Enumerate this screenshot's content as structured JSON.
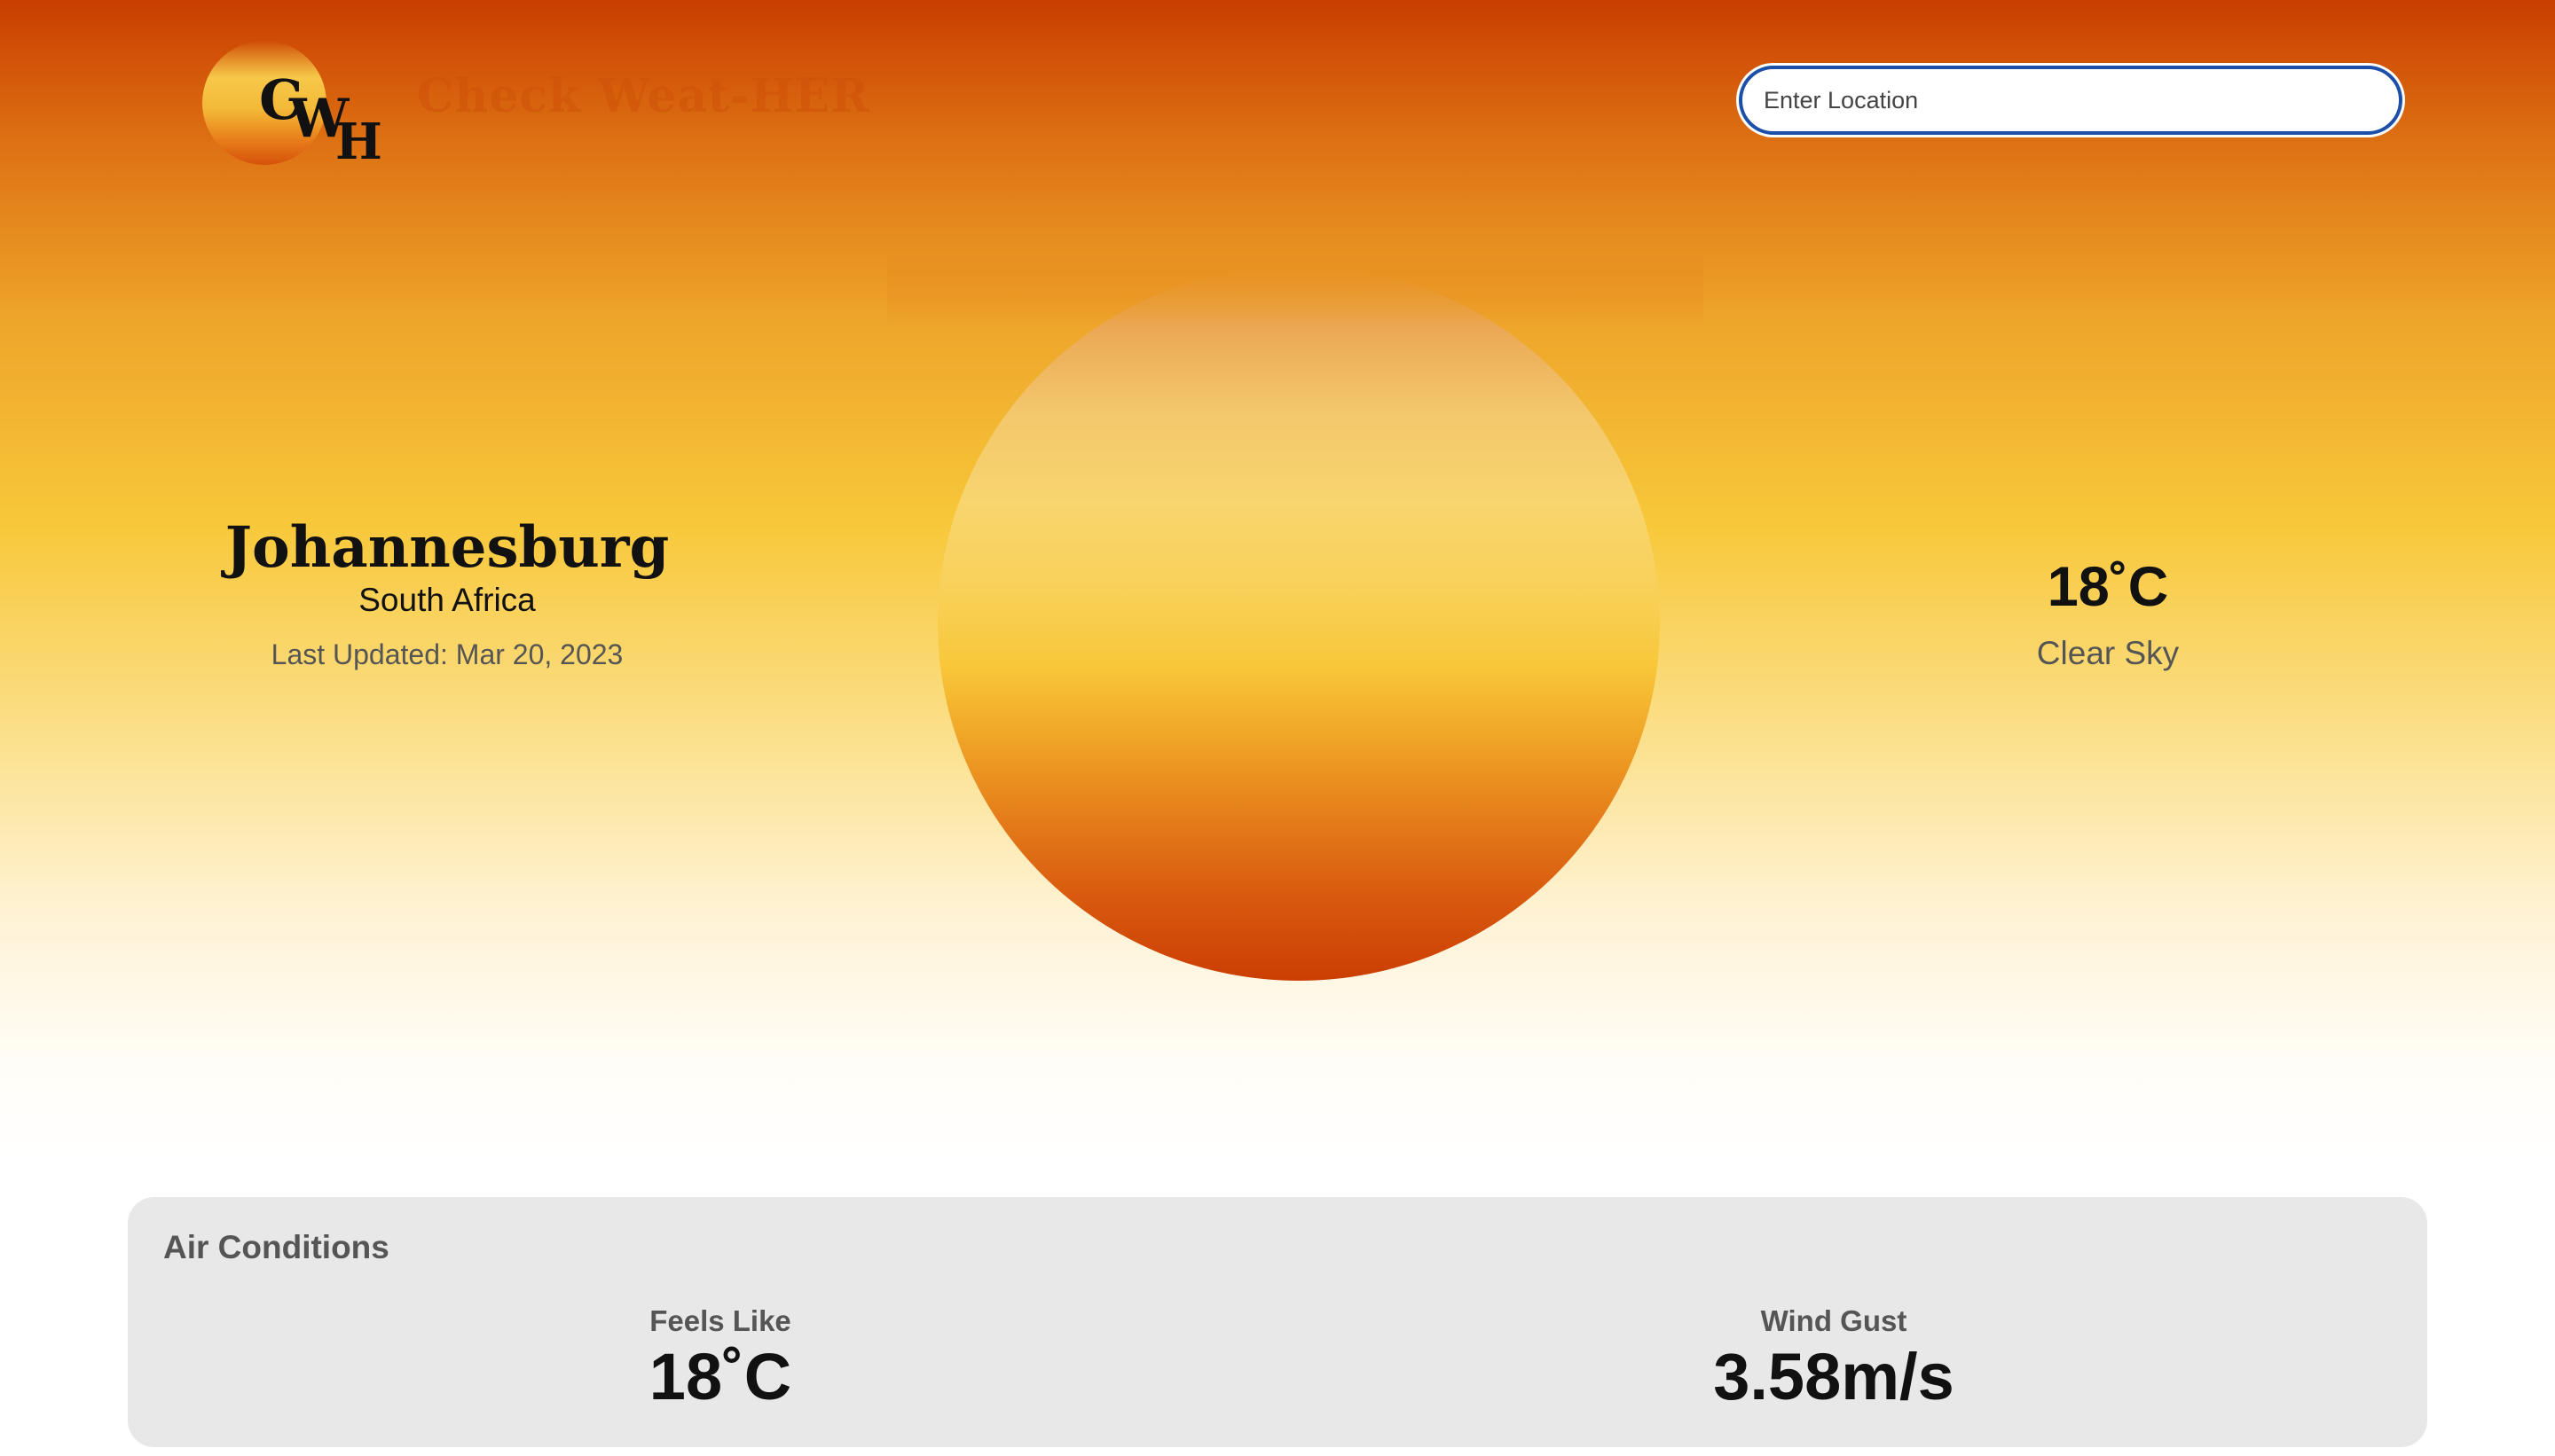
{
  "header": {
    "logo": {
      "letters": [
        "C",
        "W",
        "H"
      ]
    },
    "app_title": "Check Weat-HER",
    "search": {
      "placeholder": "Enter Location",
      "value": ""
    }
  },
  "location": {
    "city": "Johannesburg",
    "country": "South Africa",
    "last_updated": "Last Updated: Mar 20, 2023"
  },
  "current": {
    "temperature": "18˚C",
    "condition": "Clear Sky",
    "icon": "sun-icon"
  },
  "air_conditions": {
    "title": "Air Conditions",
    "metrics": [
      {
        "label": "Feels Like",
        "value": "18˚C"
      },
      {
        "label": "Wind Gust",
        "value": "3.58m/s"
      }
    ]
  },
  "colors": {
    "sky_top": "#c93e00",
    "sky_mid": "#f8c83a",
    "sun_bottom": "#cb3e03",
    "search_border": "#1c4fa8",
    "panel_bg": "#e8e8e9"
  }
}
